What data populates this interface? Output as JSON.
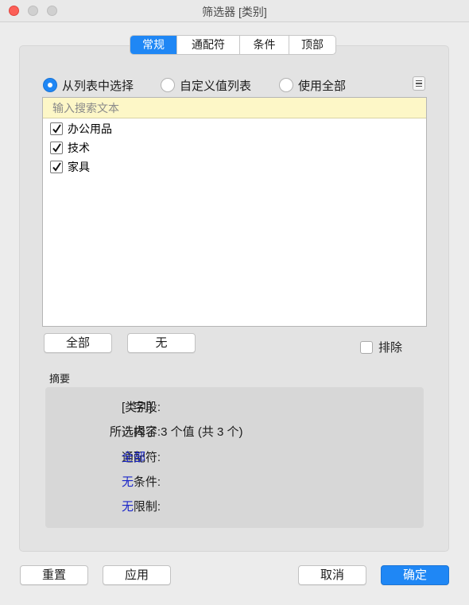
{
  "window": {
    "title": "筛选器 [类别]"
  },
  "tabs": [
    {
      "label": "常规",
      "active": true
    },
    {
      "label": "通配符",
      "active": false
    },
    {
      "label": "条件",
      "active": false
    },
    {
      "label": "顶部",
      "active": false
    }
  ],
  "mode": {
    "options": [
      {
        "label": "从列表中选择",
        "selected": true
      },
      {
        "label": "自定义值列表",
        "selected": false
      },
      {
        "label": "使用全部",
        "selected": false
      }
    ]
  },
  "list": {
    "search_placeholder": "输入搜索文本",
    "items": [
      {
        "label": "办公用品",
        "checked": true
      },
      {
        "label": "技术",
        "checked": true
      },
      {
        "label": "家具",
        "checked": true
      }
    ]
  },
  "list_actions": {
    "all_label": "全部",
    "none_label": "无"
  },
  "exclude": {
    "label": "排除",
    "checked": false
  },
  "summary": {
    "title": "摘要",
    "rows": [
      {
        "key": "字段:",
        "value": "[类别]",
        "link": false
      },
      {
        "key": "所选内容:",
        "value": "选择了 3 个值 (共 3 个)",
        "link": false
      },
      {
        "key": "通配符:",
        "value": "全部",
        "link": true
      },
      {
        "key": "条件:",
        "value": "无",
        "link": true
      },
      {
        "key": "限制:",
        "value": "无",
        "link": true
      }
    ]
  },
  "footer": {
    "reset_label": "重置",
    "apply_label": "应用",
    "cancel_label": "取消",
    "ok_label": "确定"
  },
  "colors": {
    "accent": "#1f87f5",
    "search_bg": "#fdf7c7",
    "link": "#1a26c8",
    "close": "#fc5f57"
  }
}
